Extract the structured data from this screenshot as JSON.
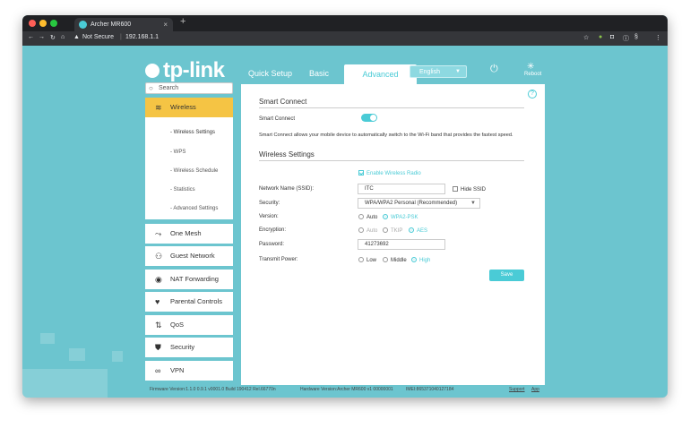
{
  "browser": {
    "tab_title": "Archer MR600",
    "tab_close": "×",
    "new_tab": "+",
    "security_label": "Not Secure",
    "url": "192.168.1.1",
    "nav_icons": [
      "back-arrow",
      "forward-arrow",
      "reload",
      "home"
    ]
  },
  "header": {
    "brand": "tp-link",
    "tabs": [
      {
        "label": "Quick Setup"
      },
      {
        "label": "Basic"
      },
      {
        "label": "Advanced"
      }
    ],
    "language": "English",
    "reboot_label": "Reboot"
  },
  "sidebar": {
    "search_placeholder": "Search",
    "items": [
      {
        "label": "Wireless",
        "icon": "wifi-icon",
        "active": true
      },
      {
        "label": "One Mesh",
        "icon": "mesh-icon"
      },
      {
        "label": "Guest Network",
        "icon": "guest-icon"
      },
      {
        "label": "NAT Forwarding",
        "icon": "nat-icon"
      },
      {
        "label": "Parental Controls",
        "icon": "heart-icon"
      },
      {
        "label": "QoS",
        "icon": "qos-icon"
      },
      {
        "label": "Security",
        "icon": "shield-icon"
      },
      {
        "label": "VPN",
        "icon": "vpn-icon"
      }
    ],
    "submenu": [
      {
        "label": "- Wireless Settings",
        "active": true
      },
      {
        "label": "- WPS"
      },
      {
        "label": "- Wireless Schedule"
      },
      {
        "label": "- Statistics"
      },
      {
        "label": "- Advanced Settings"
      }
    ]
  },
  "main": {
    "smart_connect_heading": "Smart Connect",
    "smart_connect_label": "Smart Connect",
    "smart_connect_on": true,
    "smart_connect_desc": "Smart Connect allows your mobile device to automatically switch to the Wi-Fi band that provides the fastest speed.",
    "wireless_settings_heading": "Wireless Settings",
    "enable_radio_label": "Enable Wireless Radio",
    "ssid_label": "Network Name (SSID):",
    "ssid_value": "ITC",
    "hide_ssid_label": "Hide SSID",
    "security_label": "Security:",
    "security_value": "WPA/WPA2 Personal (Recommended)",
    "version_label": "Version:",
    "version_options": [
      "Auto",
      "WPA2-PSK"
    ],
    "version_selected": "WPA2-PSK",
    "encryption_label": "Encryption:",
    "encryption_options": [
      "Auto",
      "TKIP",
      "AES"
    ],
    "encryption_selected": "AES",
    "password_label": "Password:",
    "password_value": "41273692",
    "tx_power_label": "Transmit Power:",
    "tx_power_options": [
      "Low",
      "Middle",
      "High"
    ],
    "tx_power_selected": "High",
    "save_label": "Save",
    "help_symbol": "?"
  },
  "footer": {
    "firmware": "Firmware Version:1.1.0 0.9.1 v0001.0 Build 190412 Rel.66770n",
    "hardware": "Hardware Version:Archer MR600 v1 00000001",
    "imei": "IMEI:865371040127184",
    "support": "Support",
    "app": "App"
  },
  "colors": {
    "accent": "#4acbd6",
    "background": "#6cc5cf",
    "active_item": "#f5c444"
  }
}
